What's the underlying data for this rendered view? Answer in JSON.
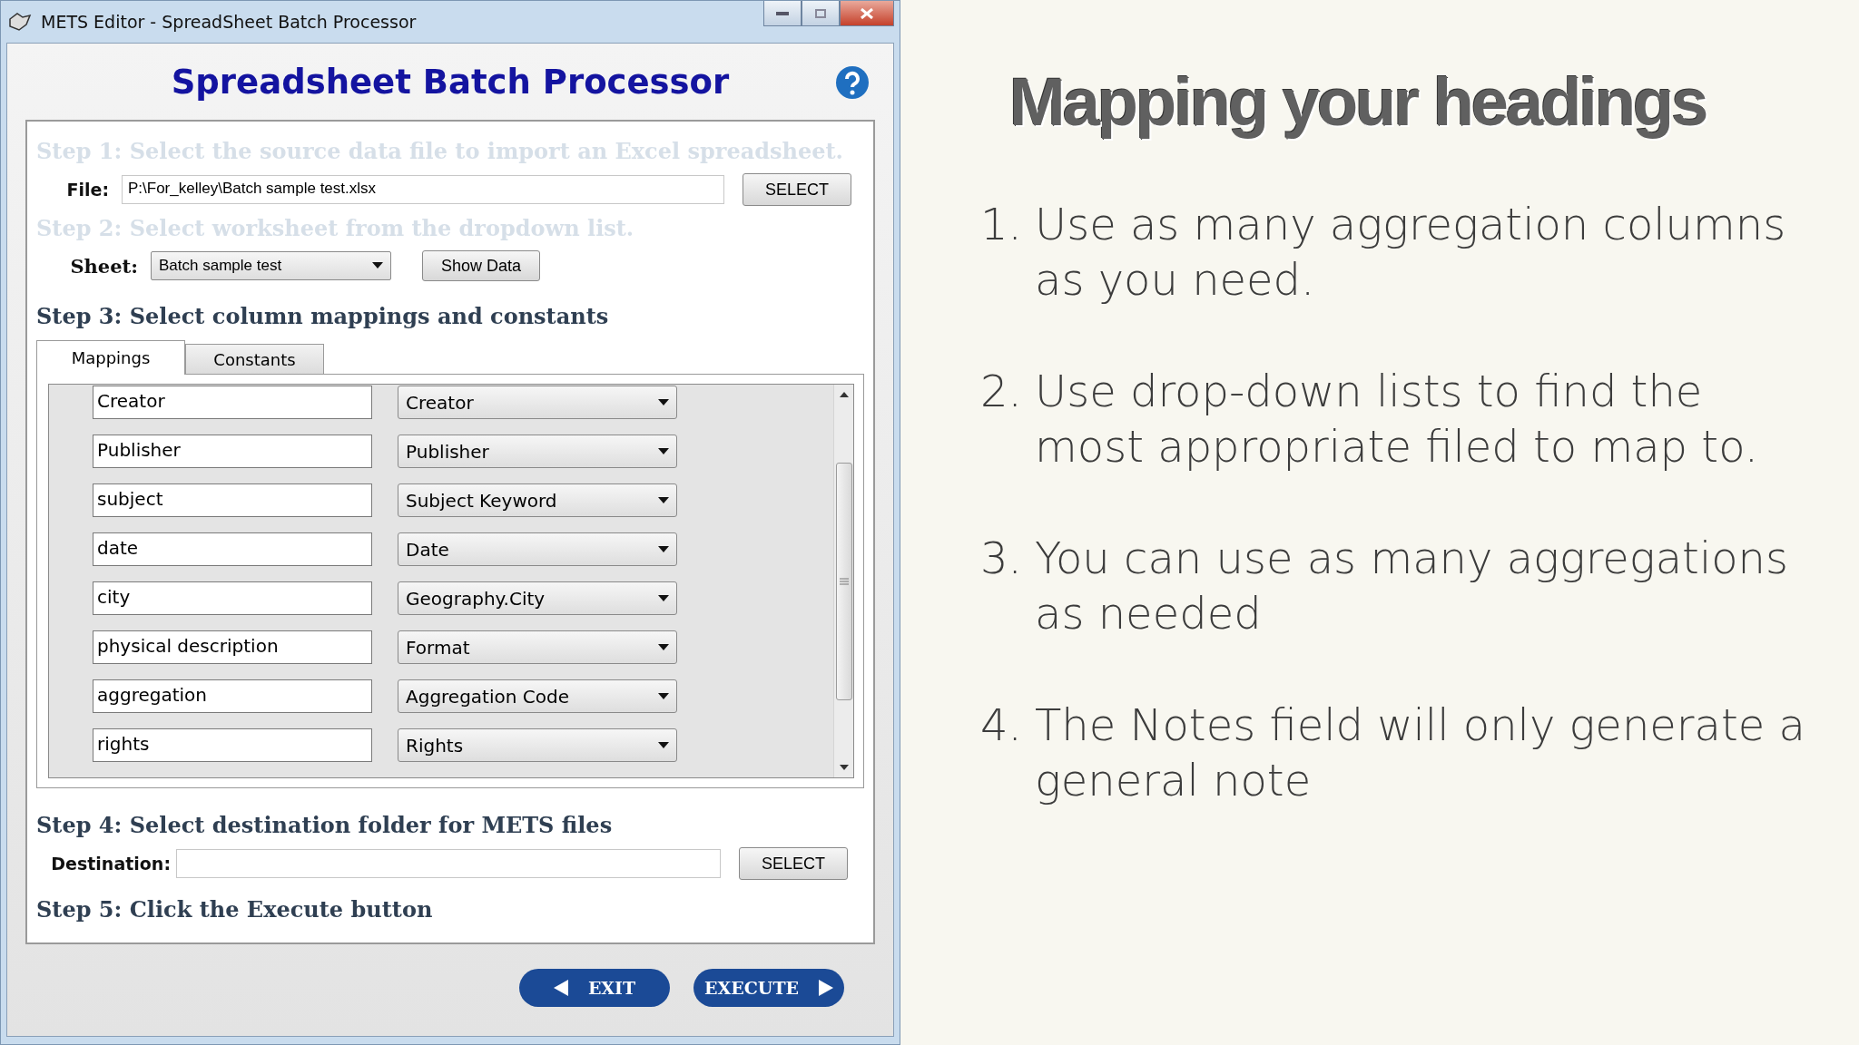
{
  "window": {
    "title": "METS Editor - SpreadSheet Batch Processor"
  },
  "app_title": "Spreadsheet Batch Processor",
  "step1": {
    "text": "Step 1: Select the source data file to import an Excel spreadsheet.",
    "disabled": true,
    "label": "File:",
    "value": "P:\\For_kelley\\Batch sample test.xlsx",
    "button": "SELECT"
  },
  "step2": {
    "text": "Step 2: Select worksheet from the dropdown list.",
    "disabled": true,
    "label": "Sheet:",
    "value": "Batch sample test",
    "button": "Show Data"
  },
  "step3": {
    "text": "Step 3: Select column mappings and constants",
    "disabled": false
  },
  "tabs": [
    {
      "label": "Mappings",
      "selected": true
    },
    {
      "label": "Constants",
      "selected": false
    }
  ],
  "mappings": [
    {
      "column": "Creator",
      "field": "Creator"
    },
    {
      "column": "Publisher",
      "field": "Publisher"
    },
    {
      "column": "subject",
      "field": "Subject Keyword"
    },
    {
      "column": "date",
      "field": "Date"
    },
    {
      "column": "city",
      "field": "Geography.City"
    },
    {
      "column": "physical description",
      "field": "Format"
    },
    {
      "column": "aggregation",
      "field": "Aggregation Code"
    },
    {
      "column": "rights",
      "field": "Rights"
    }
  ],
  "step4": {
    "text": "Step 4: Select destination folder for METS files",
    "disabled": false,
    "label": "Destination:",
    "button": "SELECT"
  },
  "step5": {
    "text": "Step 5: Click the Execute button",
    "disabled": false
  },
  "buttons": [
    {
      "label": "EXIT",
      "kind": "back"
    },
    {
      "label": "EXECUTE",
      "kind": "forward"
    }
  ],
  "slide": {
    "title": "Mapping your headings",
    "points": [
      {
        "number": "1.",
        "text": "Use as many aggregation columns as you need."
      },
      {
        "number": "2.",
        "text": "Use drop-down lists to find the most appropriate filed to map to."
      },
      {
        "number": "3.",
        "text": "You can use as many aggregations as needed"
      },
      {
        "number": "4.",
        "text": "The Notes field will only generate a general note"
      }
    ]
  }
}
